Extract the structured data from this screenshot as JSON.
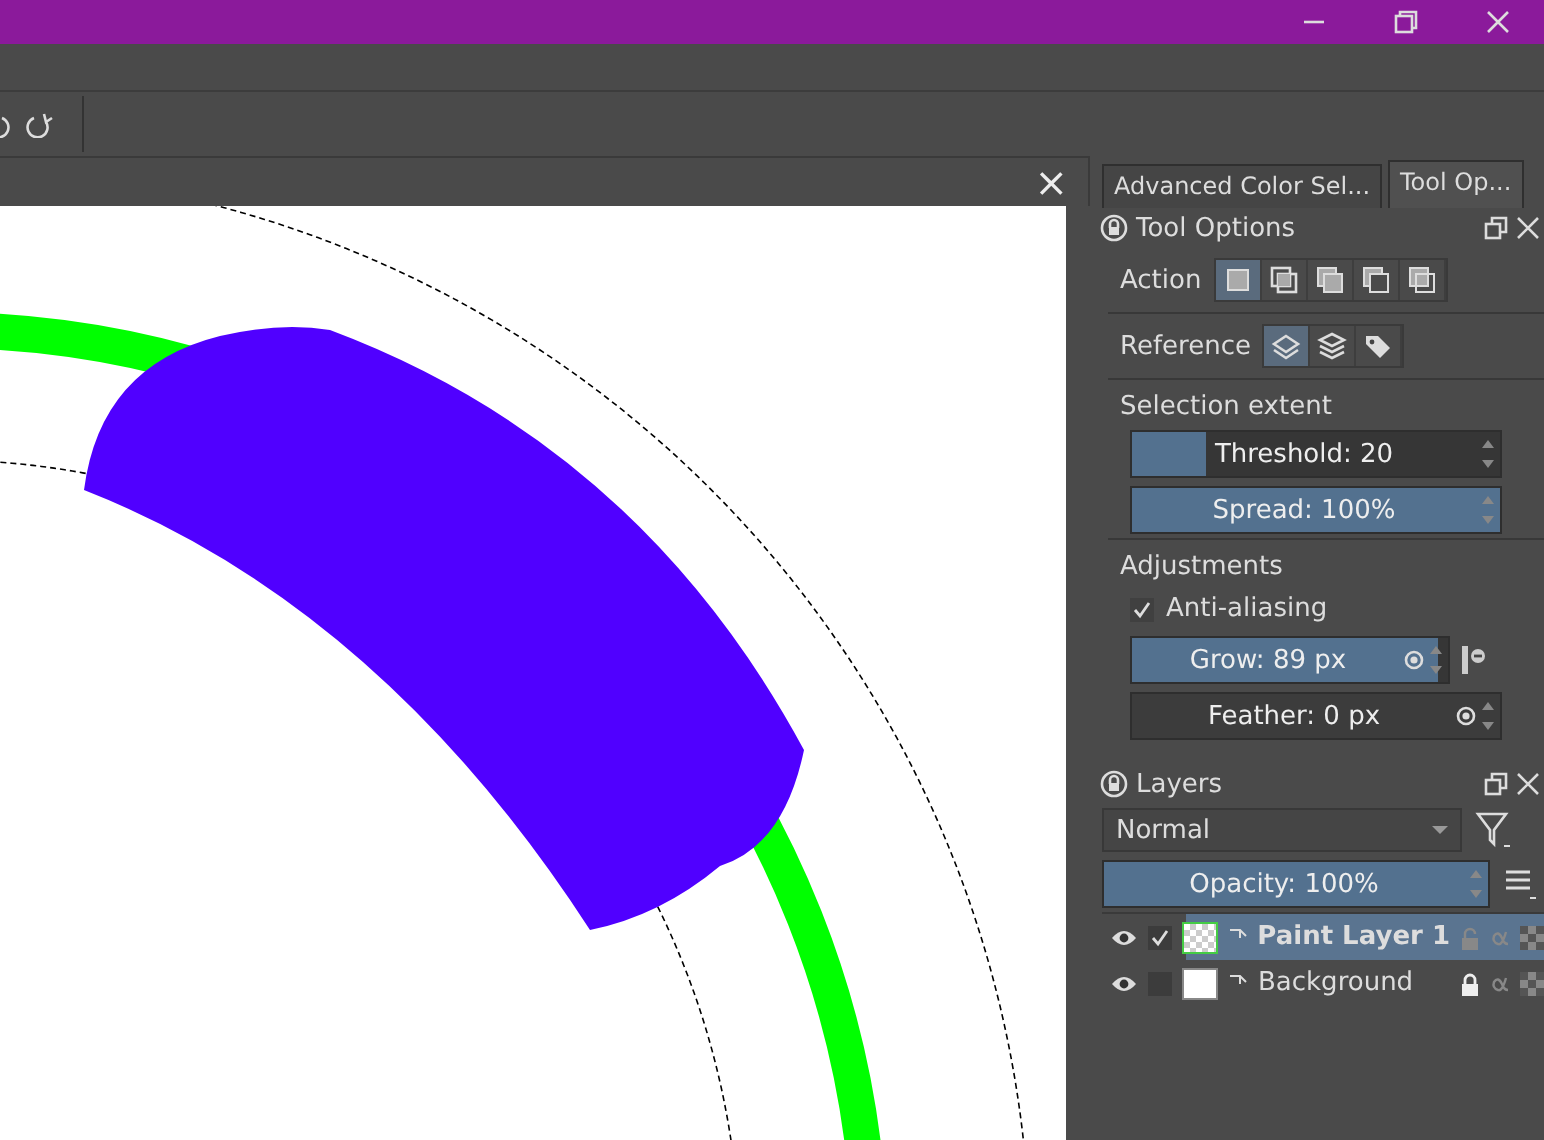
{
  "document": {
    "close": "×"
  },
  "dock_tabs": [
    {
      "label": "Advanced Color Sel...",
      "selected": false
    },
    {
      "label": "Tool Op...",
      "selected": true
    }
  ],
  "tool_options": {
    "title": "Tool Options",
    "action": {
      "label": "Action",
      "buttons": [
        {
          "kind": "replace",
          "selected": true
        },
        {
          "kind": "intersect",
          "selected": false
        },
        {
          "kind": "add",
          "selected": false
        },
        {
          "kind": "subtract",
          "selected": false
        },
        {
          "kind": "symmetric",
          "selected": false
        }
      ]
    },
    "reference": {
      "label": "Reference",
      "buttons": [
        {
          "kind": "layer",
          "selected": true
        },
        {
          "kind": "all-layers",
          "selected": false
        },
        {
          "kind": "labeled",
          "selected": false
        }
      ]
    },
    "selection_extent": {
      "title": "Selection extent",
      "sliders": [
        {
          "text": "Threshold: 20",
          "level": 0.2
        },
        {
          "text": "Spread: 100%",
          "level": 1
        }
      ]
    },
    "adjustments": {
      "title": "Adjustments",
      "anti_aliasing": {
        "label": "Anti-aliasing",
        "checked": true
      },
      "grow": {
        "text": "Grow: 89 px",
        "level": 0.97
      },
      "feather": {
        "text": "Feather: 0 px",
        "level": 0
      }
    }
  },
  "layers": {
    "title": "Layers",
    "blend_mode": "Normal",
    "opacity": {
      "text": "Opacity: 100%",
      "level": 1
    },
    "items": [
      {
        "name": "Paint Layer 1",
        "selected": true,
        "visible": true,
        "checked": true,
        "locked": false
      },
      {
        "name": "Background",
        "selected": false,
        "visible": true,
        "checked": false,
        "locked": true
      }
    ]
  }
}
